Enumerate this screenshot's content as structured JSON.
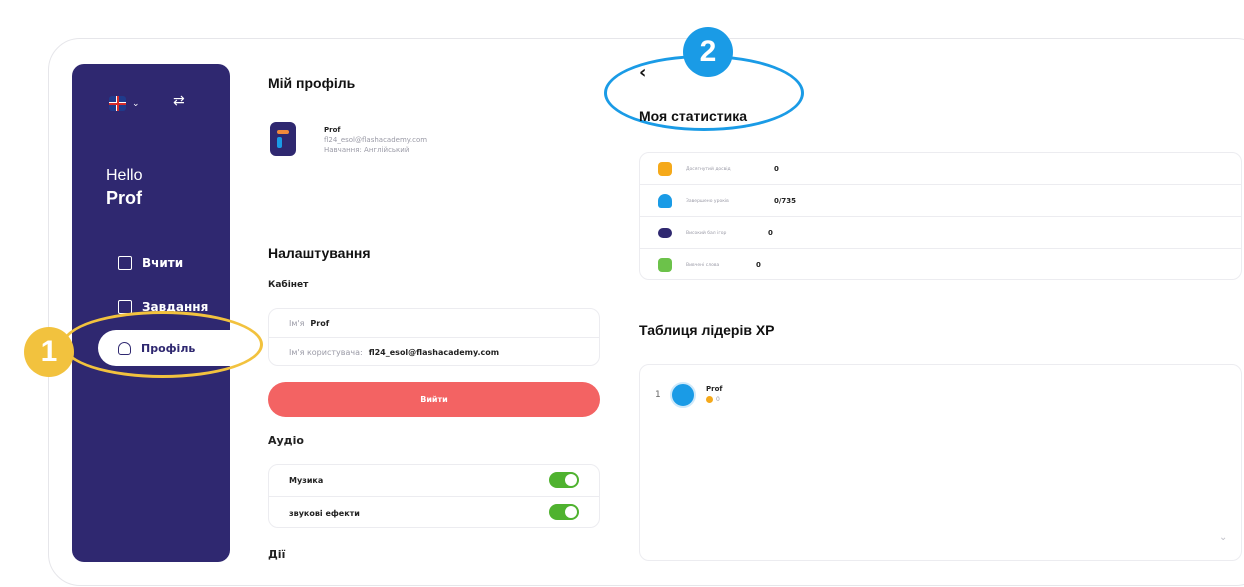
{
  "sidebar": {
    "greeting": "Hello",
    "user_name": "Prof",
    "language_flag_icon": "uk-flag-icon",
    "items": [
      {
        "label": "Вчити",
        "icon": "book-icon"
      },
      {
        "label": "Завдання",
        "icon": "tasks-icon"
      },
      {
        "label": "Профіль",
        "icon": "profile-icon",
        "active": true
      }
    ]
  },
  "callouts": {
    "one": "1",
    "two": "2"
  },
  "profile": {
    "title": "Мій профіль",
    "name": "Prof",
    "email": "fl24_esol@flashacademy.com",
    "learning": "Навчання: Англійський"
  },
  "settings": {
    "title": "Налаштування",
    "cabinet_label": "Кабінет",
    "name_label": "Ім'я",
    "name_value": "Prof",
    "username_label": "Ім'я користувача:",
    "username_value": "fl24_esol@flashacademy.com",
    "logout_label": "Вийти",
    "audio_title": "Аудіо",
    "music_label": "Музика",
    "music_on": true,
    "sfx_label": "звукові ефекти",
    "sfx_on": true,
    "actions_title": "Дії"
  },
  "stats": {
    "title": "Моя статистика",
    "rows": [
      {
        "label": "Досягнутий досвід",
        "value": "0",
        "icon": "hexagon-xp-icon",
        "color": "#f5a91a"
      },
      {
        "label": "Завершено уроків",
        "value": "0/735",
        "icon": "bell-icon",
        "color": "#1a9be6"
      },
      {
        "label": "Високий бал ігор",
        "value": "0",
        "icon": "gamepad-icon",
        "color": "#2f2870"
      },
      {
        "label": "Вивчені слова",
        "value": "0",
        "icon": "words-icon",
        "color": "#6cc24a"
      }
    ]
  },
  "leaderboard": {
    "title": "Таблиця лідерів XP",
    "entries": [
      {
        "rank": "1",
        "name": "Prof",
        "score": "0"
      }
    ]
  },
  "colors": {
    "sidebar": "#2f2870",
    "logout": "#f36363",
    "toggle": "#4fb22f",
    "callout1": "#f2c23e",
    "callout2": "#1a9be6"
  }
}
